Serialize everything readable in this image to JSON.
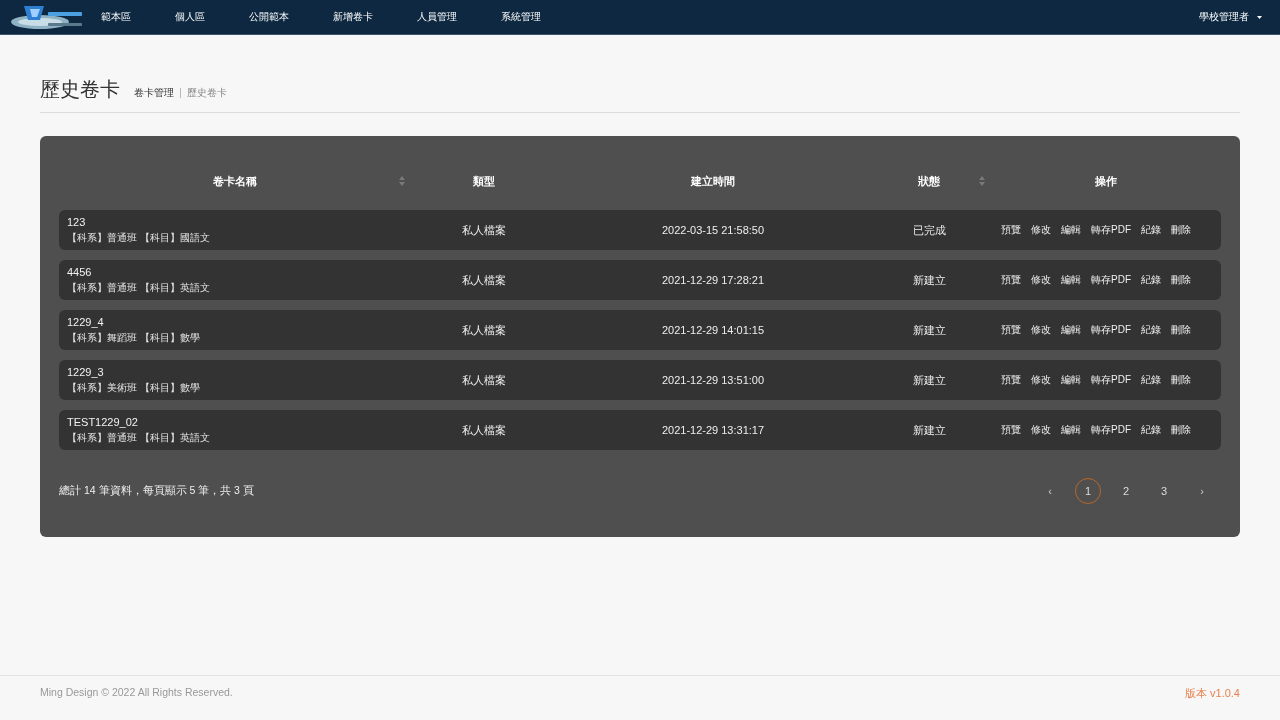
{
  "nav": {
    "items": [
      "範本區",
      "個人區",
      "公開範本",
      "新增卷卡",
      "人員管理",
      "系統管理"
    ],
    "user": "學校管理者"
  },
  "page": {
    "title": "歷史卷卡",
    "breadcrumb": [
      "卷卡管理",
      "歷史卷卡"
    ]
  },
  "table": {
    "columns": [
      {
        "label": "卷卡名稱",
        "sortable": true
      },
      {
        "label": "類型",
        "sortable": false
      },
      {
        "label": "建立時間",
        "sortable": false
      },
      {
        "label": "狀態",
        "sortable": true
      },
      {
        "label": "操作",
        "sortable": false
      }
    ],
    "rows": [
      {
        "name": "123",
        "meta": "【科系】普通班 【科目】國語文",
        "type": "私人檔案",
        "created": "2022-03-15 21:58:50",
        "status": "已完成",
        "actions": [
          "預覽",
          "修改",
          "編輯",
          "轉存PDF",
          "紀錄",
          "刪除"
        ]
      },
      {
        "name": "4456",
        "meta": "【科系】普通班 【科目】英語文",
        "type": "私人檔案",
        "created": "2021-12-29 17:28:21",
        "status": "新建立",
        "actions": [
          "預覽",
          "修改",
          "編輯",
          "轉存PDF",
          "紀錄",
          "刪除"
        ]
      },
      {
        "name": "1229_4",
        "meta": "【科系】舞蹈班 【科目】數學",
        "type": "私人檔案",
        "created": "2021-12-29 14:01:15",
        "status": "新建立",
        "actions": [
          "預覽",
          "修改",
          "編輯",
          "轉存PDF",
          "紀錄",
          "刪除"
        ]
      },
      {
        "name": "1229_3",
        "meta": "【科系】美術班 【科目】數學",
        "type": "私人檔案",
        "created": "2021-12-29 13:51:00",
        "status": "新建立",
        "actions": [
          "預覽",
          "修改",
          "編輯",
          "轉存PDF",
          "紀錄",
          "刪除"
        ]
      },
      {
        "name": "TEST1229_02",
        "meta": "【科系】普通班 【科目】英語文",
        "type": "私人檔案",
        "created": "2021-12-29 13:31:17",
        "status": "新建立",
        "actions": [
          "預覽",
          "修改",
          "編輯",
          "轉存PDF",
          "紀錄",
          "刪除"
        ]
      }
    ]
  },
  "pagination": {
    "summary": "總計 14 筆資料，每頁顯示 5 筆，共 3 頁",
    "prev": "‹",
    "pages": [
      {
        "label": "1",
        "selected": true
      },
      {
        "label": "2",
        "selected": false
      },
      {
        "label": "3",
        "selected": false
      }
    ],
    "next": "›"
  },
  "footer": {
    "copyright": "Ming Design © 2022 All Rights Reserved.",
    "version": "版本 v1.0.4"
  }
}
